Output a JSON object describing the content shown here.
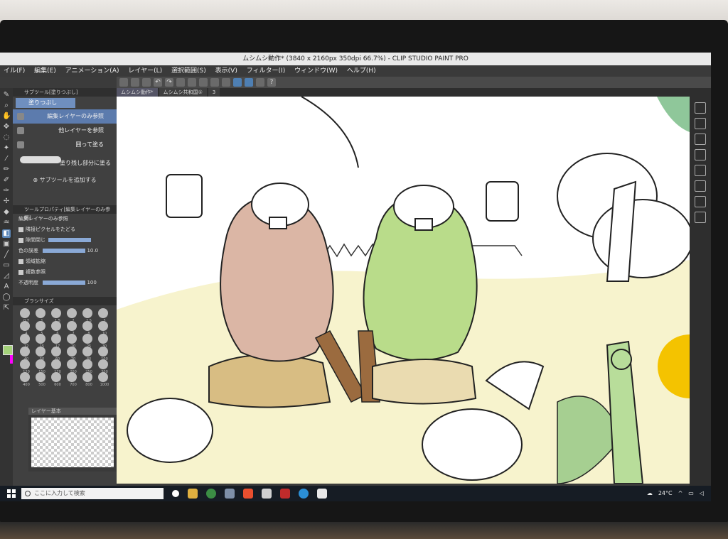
{
  "app": {
    "title": "ムシムシ動作* (3840 x 2160px 350dpi 66.7%) - CLIP STUDIO PAINT PRO"
  },
  "menu": [
    "イル(F)",
    "編集(E)",
    "アニメーション(A)",
    "レイヤー(L)",
    "選択範囲(S)",
    "表示(V)",
    "フィルター(I)",
    "ウィンドウ(W)",
    "ヘルプ(H)"
  ],
  "tabs": [
    {
      "label": "ムシムシ動作*",
      "active": true
    },
    {
      "label": "ムシムシ共和国①",
      "active": false
    },
    {
      "label": "3",
      "active": false
    }
  ],
  "subtool_panel": {
    "header": "サブツール[塗りつぶし]",
    "group": "塗りつぶし",
    "options": [
      {
        "label": "編集レイヤーのみ参照",
        "selected": true
      },
      {
        "label": "他レイヤーを参照",
        "selected": false
      },
      {
        "label": "囲って塗る",
        "selected": false
      },
      {
        "label": "塗り残し部分に塗る",
        "selected": false
      }
    ],
    "add_label": "サブツールを追加する"
  },
  "tool_property": {
    "header": "ツールプロパティ[編集レイヤーのみ参照]",
    "subtitle": "編集レイヤーのみ参照",
    "items": [
      {
        "label": "隣接ピクセルをたどる"
      },
      {
        "label": "隙間閉じ"
      },
      {
        "label": "色の誤差",
        "value": "10.0"
      },
      {
        "label": "領域拡縮"
      },
      {
        "label": "複数参照"
      },
      {
        "label": "不透明度",
        "value": "100"
      }
    ]
  },
  "brush_size": {
    "header": "ブラシサイズ",
    "sizes": [
      "0.7",
      "1",
      "1.5",
      "2",
      "2.5",
      "3",
      "4",
      "5",
      "6",
      "7",
      "8",
      "10",
      "12",
      "15",
      "17",
      "20",
      "25",
      "30",
      "40",
      "50",
      "60",
      "70",
      "80",
      "100",
      "120",
      "150",
      "170",
      "200",
      "250",
      "300",
      "400",
      "500",
      "600",
      "700",
      "800",
      "1000"
    ]
  },
  "layer_panel": {
    "header": "レイヤー基本"
  },
  "colors": {
    "main": "#a4d27a",
    "sub": "#ff00ff",
    "accent": "#4e7fb3"
  },
  "taskbar": {
    "search_placeholder": "ここに入力して検索",
    "weather": "24°C"
  }
}
